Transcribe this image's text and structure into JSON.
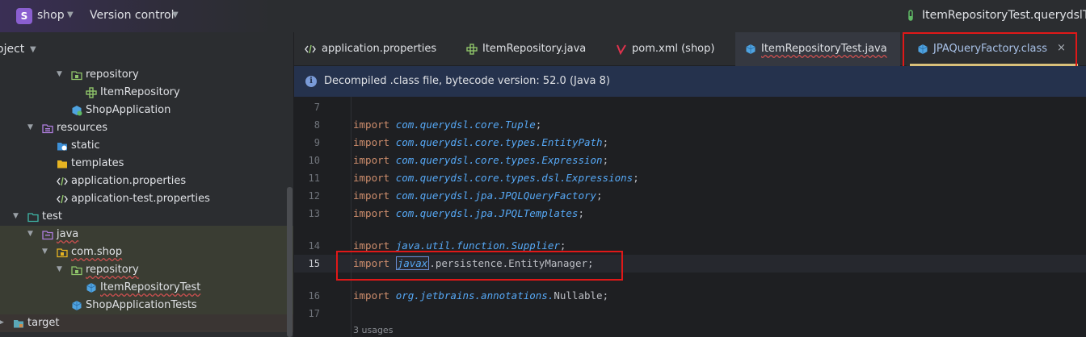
{
  "titlebar": {
    "project_initial": "S",
    "project_name": "shop",
    "vcs_label": "Version control",
    "run_config": "ItemRepositoryTest.querydslTes"
  },
  "project_panel": {
    "title": "oject",
    "tree": [
      {
        "label": "repository",
        "icon": "folder-package-icon",
        "arrow": "expanded"
      },
      {
        "label": "ItemRepository",
        "icon": "interface-icon"
      },
      {
        "label": "ShopApplication",
        "icon": "spring-class-icon"
      },
      {
        "label": "resources",
        "icon": "resources-folder-icon",
        "arrow": "expanded"
      },
      {
        "label": "static",
        "icon": "web-folder-icon"
      },
      {
        "label": "templates",
        "icon": "templates-folder-icon"
      },
      {
        "label": "application.properties",
        "icon": "properties-file-icon"
      },
      {
        "label": "application-test.properties",
        "icon": "properties-file-icon"
      },
      {
        "label": "test",
        "icon": "test-folder-icon",
        "arrow": "expanded"
      },
      {
        "label": "java",
        "icon": "test-source-folder-icon",
        "arrow": "expanded"
      },
      {
        "label": "com.shop",
        "icon": "package-icon",
        "arrow": "expanded"
      },
      {
        "label": "repository",
        "icon": "package-icon",
        "arrow": "expanded"
      },
      {
        "label": "ItemRepositoryTest",
        "icon": "test-class-icon"
      },
      {
        "label": "ShopApplicationTests",
        "icon": "test-class-icon"
      },
      {
        "label": "target",
        "icon": "excluded-folder-icon",
        "arrow": "collapsed"
      }
    ]
  },
  "tabs": [
    {
      "label": "application.properties",
      "icon": "properties-file-icon"
    },
    {
      "label": "ItemRepository.java",
      "icon": "interface-icon"
    },
    {
      "label": "pom.xml (shop)",
      "icon": "maven-icon"
    },
    {
      "label": "ItemRepositoryTest.java",
      "icon": "test-class-icon"
    },
    {
      "label": "JPAQueryFactory.class",
      "icon": "class-file-icon",
      "close": "×"
    }
  ],
  "banner": {
    "info_glyph": "i",
    "text": "Decompiled .class file, bytecode version: 52.0 (Java 8)"
  },
  "editor": {
    "lines": [
      {
        "num": "7"
      },
      {
        "num": "8",
        "kw": "import",
        "pkg": "com.querydsl.core.",
        "cls": "Tuple"
      },
      {
        "num": "9",
        "kw": "import",
        "pkg": "com.querydsl.core.types.",
        "cls": "EntityPath"
      },
      {
        "num": "10",
        "kw": "import",
        "pkg": "com.querydsl.core.types.",
        "cls": "Expression"
      },
      {
        "num": "11",
        "kw": "import",
        "pkg": "com.querydsl.core.types.dsl.",
        "cls": "Expressions"
      },
      {
        "num": "12",
        "kw": "import",
        "pkg": "com.querydsl.jpa.",
        "cls": "JPQLQueryFactory"
      },
      {
        "num": "13",
        "kw": "import",
        "pkg": "com.querydsl.jpa.",
        "cls": "JPQLTemplates"
      },
      {
        "num": "14",
        "kw": "import",
        "pkg": "java.util.function.",
        "cls": "Supplier"
      },
      {
        "num": "15",
        "kw": "import",
        "pkg1": "javax",
        "pkg2": ".persistence.",
        "cls": "EntityManager"
      },
      {
        "num": "16",
        "kw": "import",
        "pkg": "org.jetbrains.annotations.",
        "cls": "Nullable"
      },
      {
        "num": "17"
      }
    ],
    "usages": "3 usages"
  }
}
